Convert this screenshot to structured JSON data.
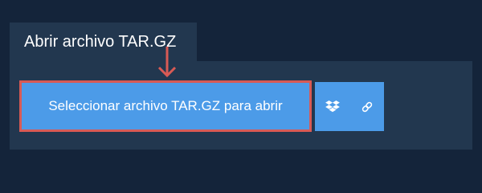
{
  "tab": {
    "title": "Abrir archivo TAR.GZ"
  },
  "buttons": {
    "open_file_label": "Seleccionar archivo TAR.GZ para abrir",
    "dropbox_icon": "dropbox-icon",
    "link_icon": "link-icon"
  },
  "colors": {
    "page_background": "#14243a",
    "panel_background": "#22374f",
    "button_blue": "#4c9be8",
    "highlight_red": "#d85a55",
    "text_white": "#ffffff"
  }
}
